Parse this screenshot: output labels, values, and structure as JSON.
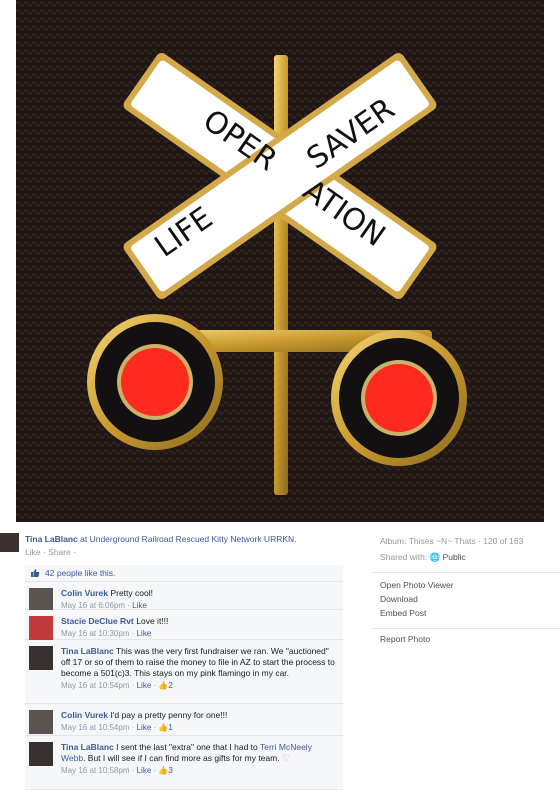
{
  "photo": {
    "pin_top_text": "OPER",
    "pin_top_right_text": "SAVER",
    "pin_bottom_left_text": "LIFE",
    "pin_bottom_right_text": "ATION"
  },
  "post": {
    "author": "Tina LaBlanc",
    "at_text": "at",
    "group": "Underground Railroad Rescued Kitty Network URRKN.",
    "like_label": "Like",
    "share_label": "Share",
    "sep": "·"
  },
  "likes": {
    "text": "42 people like this."
  },
  "comments": [
    {
      "name": "Colin Vurek",
      "text": "Pretty cool!",
      "time": "May 16 at 6:06pm",
      "like": "Like",
      "count": ""
    },
    {
      "name": "Stacie DeClue Rvt",
      "text": "Love it!!!",
      "time": "May 16 at 10:30pm",
      "like": "Like",
      "count": ""
    },
    {
      "name": "Tina LaBlanc",
      "text": "This was the very first fundraiser we ran. We \"auctioned\" off 17 or so of them to raise the money to file in AZ to start the process to become a 501(c)3. This stays on my pink flamingo in my car.",
      "time": "May 16 at 10:54pm",
      "like": "Like",
      "count": "2"
    },
    {
      "name": "Colin Vurek",
      "text": "I'd pay a pretty penny for one!!!",
      "time": "May 16 at 10:54pm",
      "like": "Like",
      "count": "1"
    },
    {
      "name": "Tina LaBlanc",
      "text": "I sent the last \"extra\" one that I had to",
      "tag": "Terri McNeely Webb",
      "text2": ". But I will see if I can find more as gifts for my team.",
      "time": "May 16 at 10:58pm",
      "like": "Like",
      "count": "3"
    }
  ],
  "sidebar": {
    "album_label": "Album:",
    "album_name": "Thises ~N~ Thats",
    "position": "· 120 of 163",
    "shared_label": "Shared with:",
    "shared_value": "Public",
    "actions": [
      "Open Photo Viewer",
      "Download",
      "Embed Post"
    ],
    "report": "Report Photo"
  },
  "colors": {
    "link": "#3b5998",
    "meta": "#9197a3",
    "panel": "#f6f7f9",
    "heart": "#e9707e"
  }
}
